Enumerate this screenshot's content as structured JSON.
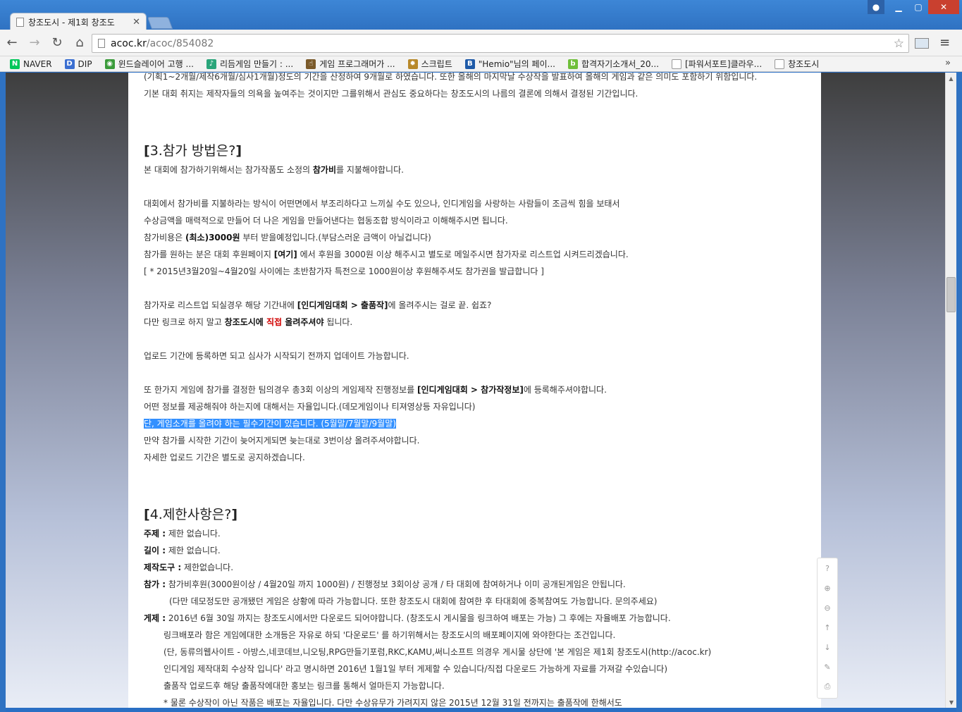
{
  "tab": {
    "title": "창조도시 - 제1회 창조도"
  },
  "address": {
    "host": "acoc.kr",
    "path": "/acoc/854082"
  },
  "bookmarks": [
    {
      "label": "NAVER",
      "icon": "naver-icon",
      "color": "#03c75a",
      "glyph": "N"
    },
    {
      "label": "DIP",
      "icon": "dip-icon",
      "color": "#3b6fd1",
      "glyph": "D"
    },
    {
      "label": "윈드슬레이어 고행 ...",
      "icon": "game-icon",
      "color": "#3a9b3a",
      "glyph": "◉"
    },
    {
      "label": "리듬게임 만들기 : ...",
      "icon": "rhythm-icon",
      "color": "#2aa57a",
      "glyph": "♪"
    },
    {
      "label": "게임 프로그래머가 ...",
      "icon": "hand-icon",
      "color": "#7a5a2a",
      "glyph": "☝"
    },
    {
      "label": "스크립트",
      "icon": "gear-icon",
      "color": "#b8892a",
      "glyph": "✹"
    },
    {
      "label": "\"Hemio\"님의 페이...",
      "icon": "bgm-store-icon",
      "color": "#1e5aa8",
      "glyph": "B"
    },
    {
      "label": "합격자기소개서_20...",
      "icon": "blog-icon",
      "color": "#6fbf3a",
      "glyph": "b"
    },
    {
      "label": "[파워서포트]클라우...",
      "icon": "page-icon",
      "color": "#999999",
      "glyph": ""
    },
    {
      "label": "창조도시",
      "icon": "page-icon",
      "color": "#999999",
      "glyph": ""
    }
  ],
  "article": {
    "top_line1": "(기획1~2개월/제작6개월/심사1개월)정도의 기간을 산정하여 9개월로 하였습니다. 또한 올해의 마지막날 수상작을 발표하여 올해의 게임과 같은 의미도 포함하기 위함입니다.",
    "top_line2": "기본 대회 취지는 제작자들의 의욕을 높여주는 것이지만 그를위해서 관심도 중요하다는 창조도시의 나름의 결론에 의해서 결정된 기간입니다.",
    "h3_open": "[",
    "h3_text": "3.참가 방법은?",
    "h3_close": "]",
    "p1_a": "본 대회에 참가하기위해서는 참가작품도 소정의 ",
    "p1_b": "참가비",
    "p1_c": "를 지불해야합니다.",
    "p2": "대회에서 참가비를 지불하라는 방식이 어떤면에서 부조리하다고 느끼실 수도 있으나, 인디게임을 사랑하는 사람들이 조금씩 힘을 보태서",
    "p3": "수상금액을 매력적으로 만들어 더 나은 게임을 만들어낸다는 협동조합 방식이라고 이해해주시면 됩니다.",
    "p4_a": "참가비용은 ",
    "p4_b": "(최소)3000원",
    "p4_c": " 부터 받을예정입니다.(부담스러운 금액이 아닐겁니다)",
    "p5_a": "참가를 원하는 분은 대회 후원페이지 ",
    "p5_b": "[여기]",
    "p5_c": " 에서 후원을 3000원 이상 해주시고 별도로 메일주시면 참가자로 리스트업 시켜드리겠습니다.",
    "p6": "[ * 2015년3월20일~4월20일 사이에는 초반참가자 특전으로 1000원이상 후원해주셔도 참가권을 발급합니다 ]",
    "p7_a": "참가자로 리스트업 되실경우 해당 기간내에 ",
    "p7_b": "[인디게임대회 > 출품작]",
    "p7_c": "에 올려주시는 걸로 끝. 쉽죠?",
    "p8_a": "다만 링크로 하지 말고 ",
    "p8_b": "창조도시에 ",
    "p8_c": "직접",
    "p8_d": " 올려주셔야",
    "p8_e": " 됩니다.",
    "p9": "업로드 기간에 등록하면 되고 심사가 시작되기 전까지 업데이트 가능합니다.",
    "p10_a": "또 한가지 게임에 참가를 결정한 팀의경우 총3회 이상의 게임제작 진행정보를 ",
    "p10_b": "[인디게임대회 > 참가작정보]",
    "p10_c": "에 등록해주셔야합니다.",
    "p11": "어떤 정보를 제공해줘야 하는지에 대해서는 자율입니다.(데모게임이나 티져영상등 자유입니다)",
    "p12": "단, 게임소개를 올려야 하는 필수기간이 있습니다. (5월말/7월말/9월말)",
    "p13": "만약 참가를 시작한 기간이 늦어지게되면 늦는대로 3번이상 올려주셔야합니다.",
    "p14": "자세한 업로드 기간은 별도로 공지하겠습니다.",
    "h4_open": "[",
    "h4_text": "4.제한사항은?",
    "h4_close": "]",
    "r1_k": "주제 :",
    "r1_v": " 제한 없습니다.",
    "r2_k": "길이 :",
    "r2_v": " 제한 없습니다.",
    "r3_k": "제작도구 :",
    "r3_v": " 제한없습니다.",
    "r4_k": "참가 :",
    "r4_v": " 참가비후원(3000원이상 / 4월20일 까지 1000원) / 진행정보 3회이상 공개 / 타 대회에 참여하거나 이미 공개된게임은 안됩니다.",
    "r4_2": "(다만 데모정도만 공개됐던 게임은 상황에 따라 가능합니다. 또한 창조도시 대회에 참여한 후 타대회에 중복참여도 가능합니다. 문의주세요)",
    "r5_k": "게제 :",
    "r5_v": " 2016년 6월 30일 까지는 창조도시에서만 다운로드 되어야합니다. (창조도시 게시물을 링크하여 배포는 가능) 그 후에는 자율배포 가능합니다.",
    "r5_2": "링크배포라 함은 게임에대한 소개등은 자유로 하되 '다운로드' 를 하기위해서는 창조도시의 배포페이지에 와야한다는 조건입니다.",
    "r5_3": "(단, 동류의웹사이트 - 아방스,네코데브,니오팅,RPG만들기포럼,RKC,KAMU,써니소프트 의경우 게시물 상단에 '본 게임은 제1회 창조도시(http://acoc.kr)",
    "r5_4": " 인디게임 제작대회 수상작 입니다' 라고 명시하면 2016년 1월1일 부터 게제할 수 있습니다/직접 다운로드 가능하게 자료를 가져갈 수있습니다)",
    "r5_5": "출품작 업로드후 해당 출품작에대한 홍보는 링크를 통해서 얼마든지 가능합니다.",
    "r5_6": "* 물론 수상작이 아닌 작품은 배포는 자율입니다. 다만 수상유무가 가려지지 않은 2015년 12월 31일 전까지는 출품작에 한해서도"
  },
  "tools": [
    "?",
    "⊕",
    "⊖",
    "↑",
    "↓",
    "✎",
    "⎙"
  ]
}
